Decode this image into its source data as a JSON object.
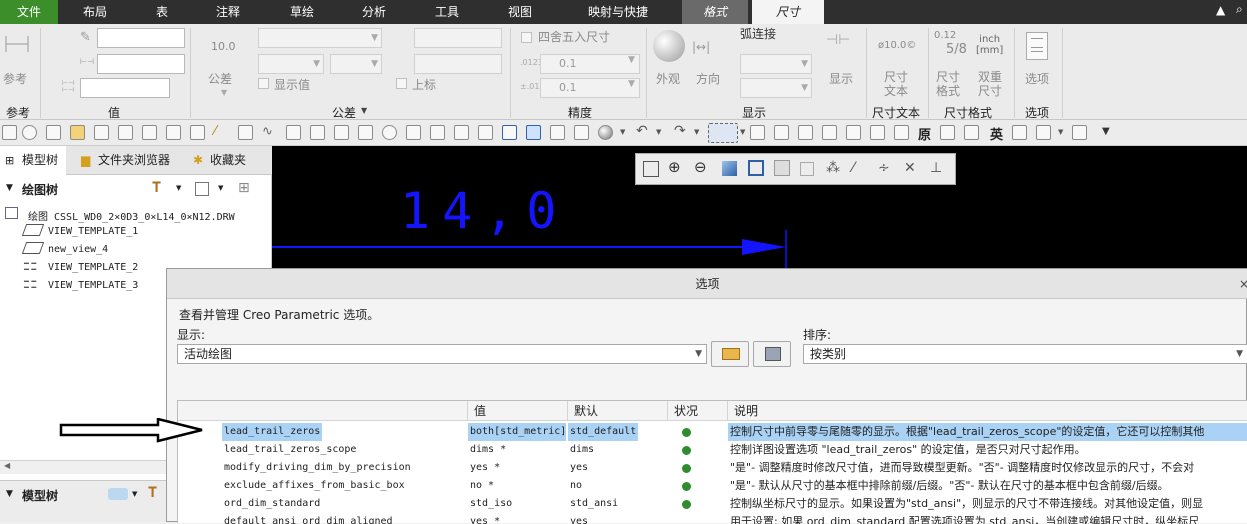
{
  "menubar": {
    "file": "文件",
    "layout": "布局",
    "table": "表",
    "annotate": "注释",
    "sketch": "草绘",
    "analysis": "分析",
    "tools": "工具",
    "view": "视图",
    "map_shortcut": "映射与快捷",
    "format": "格式",
    "dimension": "尺寸"
  },
  "ribbon": {
    "reference_btn": "参考",
    "reference_group": "参考",
    "value_group": "值",
    "tolerance_btn": "公差",
    "tolerance_display": "10.0",
    "show_value": "显示值",
    "upper_limit": "上标",
    "tolerance_group": "公差",
    "round_dims": "四舍五入尺寸",
    "precision_value_1": "0.1",
    "precision_value_2": "0.1",
    "precision_group": "精度",
    "appearance": "外观",
    "direction": "方向",
    "arc_connect": "弧连接",
    "show": "显示",
    "display_group": "显示",
    "dim_text_icon": "ø10.0©",
    "dim_text": [
      "尺寸",
      "文本"
    ],
    "dim_text_group": "尺寸文本",
    "dim_format": [
      "尺寸",
      "格式"
    ],
    "dual_dim": [
      "双重",
      "尺寸"
    ],
    "inch_mm": [
      "inch",
      "[mm]"
    ],
    "frac_label": "0.12",
    "frac_display": "5/8",
    "dim_format_group": "尺寸格式",
    "options_btn": "选项",
    "options_group": "选项"
  },
  "toolbar": {
    "chars": [
      "原",
      "英"
    ]
  },
  "leftpane": {
    "tabs": [
      "模型树",
      "文件夹浏览器",
      "收藏夹"
    ],
    "drawing_tree_title": "绘图树",
    "drawing_name": "绘图 CSSL_WD0_2×0D3_0×L14_0×N12.DRW",
    "views": [
      "VIEW_TEMPLATE_1",
      "new_view_4",
      "VIEW_TEMPLATE_2",
      "VIEW_TEMPLATE_3"
    ],
    "model_tree_title": "模型树"
  },
  "canvas": {
    "dimension_text": "14,0"
  },
  "dialog": {
    "title": "选项",
    "description": "查看并管理 Creo Parametric 选项。",
    "show_label": "显示:",
    "show_value": "活动绘图",
    "sort_label": "排序:",
    "sort_value": "按类别",
    "columns": [
      "值",
      "默认",
      "状况",
      "说明"
    ],
    "rows": [
      {
        "name": "lead_trail_zeros",
        "value": "both[std_metric]",
        "default": "std_default",
        "desc": "控制尺寸中前导零与尾随零的显示。根据\"lead_trail_zeros_scope\"的设定值，它还可以控制其他"
      },
      {
        "name": "lead_trail_zeros_scope",
        "value": "dims *",
        "default": "dims",
        "desc": "控制详图设置选项 \"lead_trail_zeros\" 的设定值，是否只对尺寸起作用。"
      },
      {
        "name": "modify_driving_dim_by_precision",
        "value": "yes *",
        "default": "yes",
        "desc": "\"是\"- 调整精度时修改尺寸值，进而导致模型更新。\"否\"- 调整精度时仅修改显示的尺寸，不会对"
      },
      {
        "name": "exclude_affixes_from_basic_box",
        "value": "no *",
        "default": "no",
        "desc": "\"是\"- 默认从尺寸的基本框中排除前缀/后缀。\"否\"- 默认在尺寸的基本框中包含前缀/后缀。"
      },
      {
        "name": "ord_dim_standard",
        "value": "std_iso",
        "default": "std_ansi",
        "desc": "控制纵坐标尺寸的显示。如果设置为\"std_ansi\"，则显示的尺寸不带连接线。对其他设定值，则显"
      },
      {
        "name": "default_ansi_ord_dim_aligned",
        "value": "yes *",
        "default": "yes",
        "desc": "用于设置: 如果 ord_dim_standard 配置选项设置为 std_ansi，当创建或编辑尺寸时，纵坐标尺"
      }
    ]
  },
  "colors": {
    "menubar_bg": "#2f2f2f",
    "file_tab": "#3b8e2a",
    "canvas_bg": "#000000",
    "dimension_blue": "#1414ff",
    "selection": "#a9d2f5",
    "status_green": "#2e8b2e"
  }
}
